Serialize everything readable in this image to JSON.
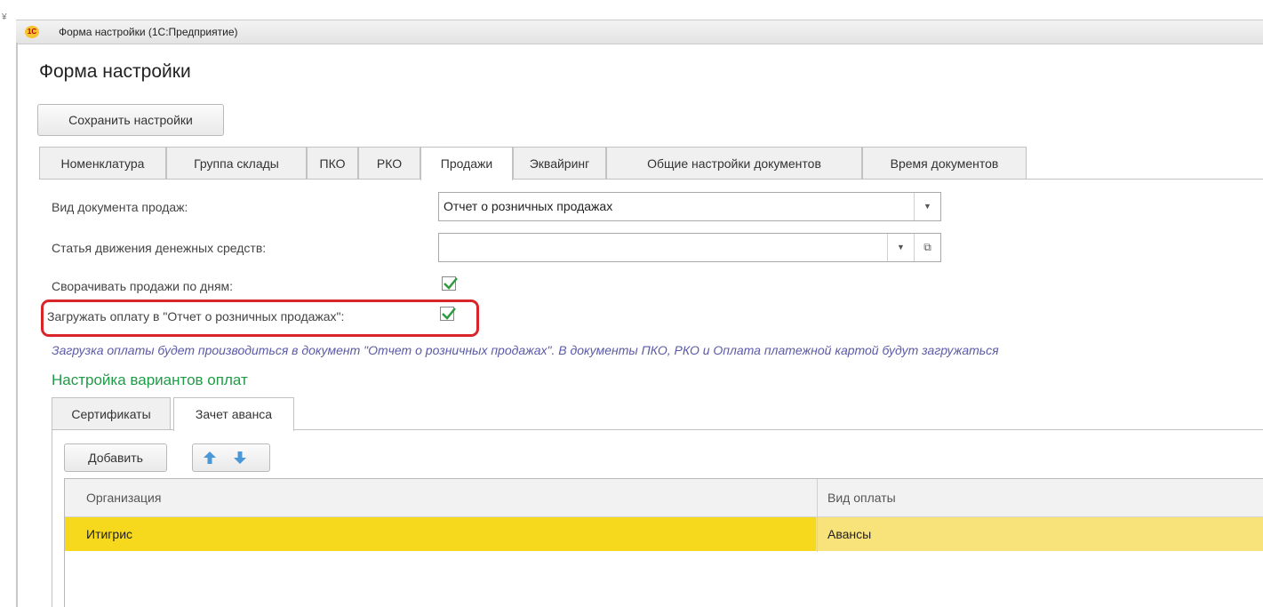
{
  "window": {
    "title": "Форма настройки  (1С:Предприятие)",
    "logo_text": "1С",
    "corner_mark": "¥"
  },
  "form": {
    "title": "Форма настройки",
    "save_button": "Сохранить настройки"
  },
  "tabs": [
    {
      "label": "Номенклатура",
      "active": false
    },
    {
      "label": "Группа склады",
      "active": false
    },
    {
      "label": "ПКО",
      "active": false
    },
    {
      "label": "РКО",
      "active": false
    },
    {
      "label": "Продажи",
      "active": true
    },
    {
      "label": "Эквайринг",
      "active": false
    },
    {
      "label": "Общие настройки документов",
      "active": false
    },
    {
      "label": "Время документов",
      "active": false
    }
  ],
  "fields": {
    "sales_doc_type": {
      "label": "Вид документа продаж:",
      "value": "Отчет о розничных продажах"
    },
    "cash_flow_item": {
      "label": "Статья движения денежных средств:",
      "value": ""
    },
    "collapse_sales_by_day": {
      "label": "Сворачивать продажи по дням:",
      "checked": true
    },
    "load_payment_to_report": {
      "label": "Загружать оплату в \"Отчет о розничных продажах\":",
      "checked": true
    }
  },
  "hint": "Загрузка оплаты будет производиться в документ \"Отчет о розничных продажах\". В документы ПКО, РКО и Оплата платежной картой будут загружаться",
  "payment_section": {
    "title": "Настройка вариантов оплат",
    "tabs": [
      {
        "label": "Сертификаты",
        "active": false
      },
      {
        "label": "Зачет аванса",
        "active": true
      }
    ],
    "add_button": "Добавить",
    "move_up_icon": "arrow-up-icon",
    "move_down_icon": "arrow-down-icon",
    "columns": [
      "Организация",
      "Вид оплаты"
    ],
    "rows": [
      {
        "organization": "Итигрис",
        "payment_type": "Авансы"
      }
    ]
  },
  "colors": {
    "highlight": "#d9252a",
    "section_title": "#1f9b47",
    "hint": "#5a5aa8",
    "selected_row": "#f6d91c",
    "checkmark": "#2e9c3e"
  }
}
